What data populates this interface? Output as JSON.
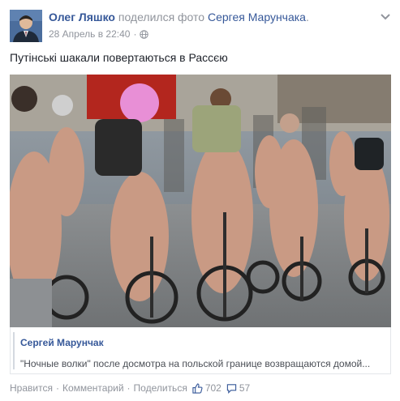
{
  "post": {
    "author": "Олег Ляшко",
    "shared_text": " поделился фото ",
    "shared_owner": "Сергея Марунчака",
    "shared_suffix": ".",
    "date": "28 Апрель в 22:40",
    "date_separator": "·",
    "privacy_icon": "globe-icon",
    "menu_icon": "chevron-down-icon",
    "text": "Путінські шакали повертаються в Рассєю"
  },
  "photo": {
    "description_icon": "shared-photo"
  },
  "shared_preview": {
    "author": "Сергей Марунчак",
    "quote": "\"Ночные волки\" после досмотра на польской границе возвращаются домой..."
  },
  "actions": {
    "like": "Нравится",
    "comment": "Комментарий",
    "share": "Поделиться",
    "separator": "·",
    "likes_count": "702",
    "comments_count": "57",
    "like_icon": "thumbs-up-icon",
    "comment_icon": "comment-bubble-icon"
  },
  "colors": {
    "link": "#365899",
    "muted": "#90949c",
    "text": "#1d2129"
  }
}
